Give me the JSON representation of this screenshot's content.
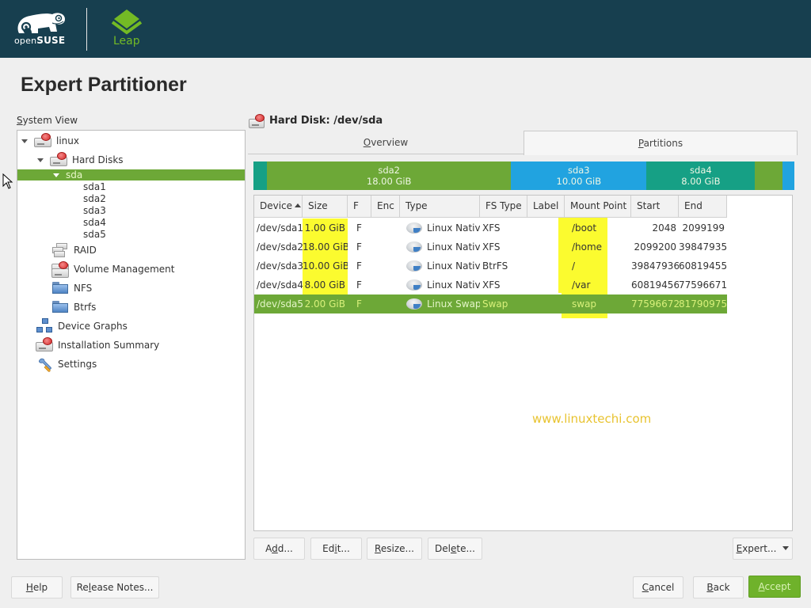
{
  "header": {
    "brand": "openSUSE",
    "brand_prefix": "open",
    "brand_suffix": "SUSE",
    "product": "Leap",
    "colors": {
      "bar": "#173f4f",
      "accent": "#73ba25"
    }
  },
  "page_title": "Expert Partitioner",
  "system_view": {
    "label": "System View",
    "label_mnemonic": "S",
    "label_rest": "ystem View",
    "tree": [
      {
        "label": "linux",
        "icon": "hard-disk-icon",
        "level": 0,
        "expanded": true
      },
      {
        "label": "Hard Disks",
        "icon": "hard-disk-icon",
        "level": 1,
        "expanded": true
      },
      {
        "label": "sda",
        "icon": "",
        "level": 2,
        "expanded": true,
        "selected": true
      },
      {
        "label": "sda1",
        "level": 3
      },
      {
        "label": "sda2",
        "level": 3
      },
      {
        "label": "sda3",
        "level": 3
      },
      {
        "label": "sda4",
        "level": 3
      },
      {
        "label": "sda5",
        "level": 3
      },
      {
        "label": "RAID",
        "icon": "raid-icon",
        "level": 1
      },
      {
        "label": "Volume Management",
        "icon": "volume-management-icon",
        "level": 1
      },
      {
        "label": "NFS",
        "icon": "nfs-folder-icon",
        "level": 1
      },
      {
        "label": "Btrfs",
        "icon": "btrfs-folder-icon",
        "level": 1
      },
      {
        "label": "Device Graphs",
        "icon": "device-graphs-icon",
        "level": 0
      },
      {
        "label": "Installation Summary",
        "icon": "installation-summary-icon",
        "level": 0
      },
      {
        "label": "Settings",
        "icon": "settings-icon",
        "level": 0
      }
    ]
  },
  "disk_panel": {
    "title": "Hard Disk: /dev/sda",
    "tabs": [
      {
        "label": "Overview",
        "mnemonic": "O",
        "rest": "verview",
        "active": false
      },
      {
        "label": "Partitions",
        "mnemonic": "P",
        "rest": "artitions",
        "active": true
      }
    ],
    "disk_bar": [
      {
        "name": "sda1",
        "size": "1.00 GiB",
        "color": "#16a085",
        "show_label": false
      },
      {
        "name": "sda2",
        "size": "18.00 GiB",
        "color": "#6da837",
        "show_label": true
      },
      {
        "name": "sda3",
        "size": "10.00 GiB",
        "color": "#21a3e0",
        "show_label": true
      },
      {
        "name": "sda4",
        "size": "8.00 GiB",
        "color": "#16a085",
        "show_label": true
      },
      {
        "name": "sda5",
        "size": "2.00 GiB",
        "color": "#6da837",
        "show_label": false
      },
      {
        "name": "free",
        "size": "",
        "color": "#21a3e0",
        "show_label": false
      }
    ],
    "table": {
      "columns": [
        "Device",
        "Size",
        "F",
        "Enc",
        "Type",
        "FS Type",
        "Label",
        "Mount Point",
        "Start",
        "End"
      ],
      "sort_column": "Device",
      "sort_direction": "ascending",
      "rows": [
        {
          "device": "/dev/sda1",
          "size": "1.00 GiB",
          "f": "F",
          "enc": "",
          "type": "Linux Native",
          "fs_type": "XFS",
          "label": "",
          "mount_point": "/boot",
          "start": "2048",
          "end": "2099199",
          "selected": false
        },
        {
          "device": "/dev/sda2",
          "size": "18.00 GiB",
          "f": "F",
          "enc": "",
          "type": "Linux Native",
          "fs_type": "XFS",
          "label": "",
          "mount_point": "/home",
          "start": "2099200",
          "end": "39847935",
          "selected": false
        },
        {
          "device": "/dev/sda3",
          "size": "10.00 GiB",
          "f": "F",
          "enc": "",
          "type": "Linux Native",
          "fs_type": "BtrFS",
          "label": "",
          "mount_point": "/",
          "start": "39847936",
          "end": "60819455",
          "selected": false
        },
        {
          "device": "/dev/sda4",
          "size": "8.00 GiB",
          "f": "F",
          "enc": "",
          "type": "Linux Native",
          "fs_type": "XFS",
          "label": "",
          "mount_point": "/var",
          "start": "60819456",
          "end": "77596671",
          "selected": false
        },
        {
          "device": "/dev/sda5",
          "size": "2.00 GiB",
          "f": "F",
          "enc": "",
          "type": "Linux Swap",
          "fs_type": "Swap",
          "label": "",
          "mount_point": "swap",
          "start": "77596672",
          "end": "81790975",
          "selected": true
        }
      ]
    },
    "watermark": "www.linuxtechi.com",
    "actions": {
      "add": {
        "label": "Add...",
        "pre": "A",
        "mn": "d",
        "post": "d..."
      },
      "edit": {
        "label": "Edit...",
        "pre": "Ed",
        "mn": "i",
        "post": "t..."
      },
      "resize": {
        "label": "Resize...",
        "pre": "",
        "mn": "R",
        "post": "esize..."
      },
      "delete": {
        "label": "Delete...",
        "pre": "Del",
        "mn": "e",
        "post": "te..."
      },
      "expert": {
        "label": "Expert...",
        "pre": "",
        "mn": "E",
        "post": "xpert..."
      }
    }
  },
  "footer": {
    "help": {
      "label": "Help",
      "pre": "",
      "mn": "H",
      "post": "elp"
    },
    "release_notes": {
      "label": "Release Notes...",
      "pre": "Re",
      "mn": "l",
      "post": "ease Notes..."
    },
    "cancel": {
      "label": "Cancel",
      "pre": "",
      "mn": "C",
      "post": "ancel"
    },
    "back": {
      "label": "Back",
      "pre": "",
      "mn": "B",
      "post": "ack"
    },
    "accept": {
      "label": "Accept",
      "pre": "",
      "mn": "A",
      "post": "ccept"
    }
  }
}
